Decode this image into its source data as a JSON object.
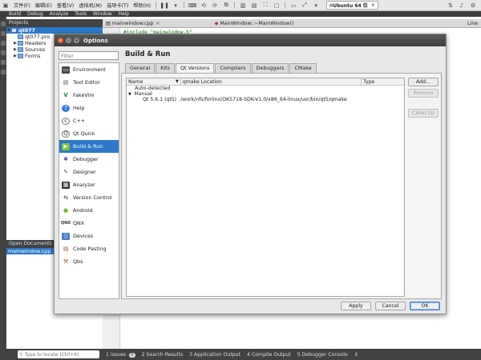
{
  "host_toolbar": {
    "menus": [
      "文件(F)",
      "编辑(E)",
      "查看(V)",
      "虚拟机(M)",
      "选项卡(T)",
      "帮助(H)"
    ],
    "vm_tab": "Ubuntu 64 位",
    "vm_tab_close": "×"
  },
  "qt_menu": [
    "Build",
    "Debug",
    "Analyze",
    "Tools",
    "Window",
    "Help"
  ],
  "projects": {
    "header": "Projects",
    "tree": [
      {
        "label": "qt077",
        "level": 0,
        "selected": true
      },
      {
        "label": "qt077.pro",
        "level": 1
      },
      {
        "label": "Headers",
        "level": 1
      },
      {
        "label": "Sources",
        "level": 1
      },
      {
        "label": "Forms",
        "level": 1
      }
    ]
  },
  "open_documents": {
    "header": "Open Documents",
    "items": [
      "mainwindow.cpp"
    ]
  },
  "editor": {
    "tabs": [
      "mainwindow.cpp",
      "MainWindow::~MainWindow()",
      "Line"
    ],
    "code_line": "#include \"mainwindow.h\""
  },
  "status_bar": {
    "locator_placeholder": "Type to locate (Ctrl+K)",
    "items": [
      {
        "num": "1",
        "label": "Issues",
        "badge": "0"
      },
      {
        "num": "2",
        "label": "Search Results"
      },
      {
        "num": "3",
        "label": "Application Output"
      },
      {
        "num": "4",
        "label": "Compile Output"
      },
      {
        "num": "5",
        "label": "Debugger Console"
      }
    ]
  },
  "dialog": {
    "title": "Options",
    "filter_placeholder": "Filter",
    "categories": [
      {
        "label": "Environment",
        "icon": "environment-icon"
      },
      {
        "label": "Text Editor",
        "icon": "text-editor-icon"
      },
      {
        "label": "FakeVim",
        "icon": "fakevim-icon"
      },
      {
        "label": "Help",
        "icon": "help-icon"
      },
      {
        "label": "C++",
        "icon": "cpp-icon"
      },
      {
        "label": "Qt Quick",
        "icon": "qt-quick-icon"
      },
      {
        "label": "Build & Run",
        "icon": "build-run-icon",
        "selected": true
      },
      {
        "label": "Debugger",
        "icon": "debugger-icon"
      },
      {
        "label": "Designer",
        "icon": "designer-icon"
      },
      {
        "label": "Analyzer",
        "icon": "analyzer-icon"
      },
      {
        "label": "Version Control",
        "icon": "version-control-icon"
      },
      {
        "label": "Android",
        "icon": "android-icon"
      },
      {
        "label": "QNX",
        "icon": "qnx-icon"
      },
      {
        "label": "Devices",
        "icon": "devices-icon"
      },
      {
        "label": "Code Pasting",
        "icon": "code-pasting-icon"
      },
      {
        "label": "Qbs",
        "icon": "qbs-icon"
      }
    ],
    "page_title": "Build & Run",
    "tabs": [
      {
        "label": "General"
      },
      {
        "label": "Kits"
      },
      {
        "label": "Qt Versions",
        "active": true
      },
      {
        "label": "Compilers"
      },
      {
        "label": "Debuggers"
      },
      {
        "label": "CMake"
      }
    ],
    "tree": {
      "columns": {
        "name": "Name",
        "location": "qmake Location",
        "type": "Type"
      },
      "rows": [
        {
          "name": "Auto-detected",
          "level": 1,
          "location": ""
        },
        {
          "name": "Manual",
          "level": 0,
          "expanded": true,
          "location": ""
        },
        {
          "name": "Qt 5.6.1 (qt5)",
          "level": 2,
          "location": "/work/nfs/forlinx/OK5718-SDK-V1.0/x86_64-linux/usr/bin/qt5/qmake"
        }
      ]
    },
    "side_buttons": {
      "add": "Add...",
      "remove": "Remove",
      "clean_up": "Clean Up"
    },
    "buttons": {
      "apply": "Apply",
      "cancel": "Cancel",
      "ok": "OK"
    }
  }
}
